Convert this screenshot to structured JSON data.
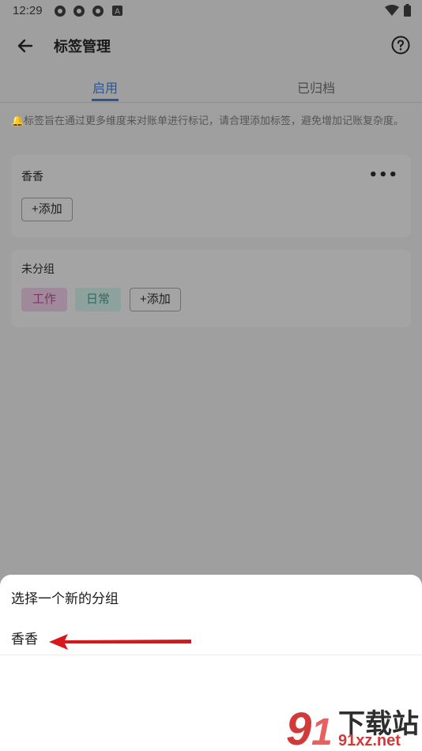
{
  "status_bar": {
    "time": "12:29",
    "icons": [
      "app-icon",
      "app-icon",
      "app-icon",
      "a-icon",
      "wifi-icon",
      "battery-icon"
    ]
  },
  "app_bar": {
    "title": "标签管理",
    "back_icon": "arrow-left-icon",
    "help_icon": "help-circle-icon"
  },
  "tabs": [
    {
      "label": "启用",
      "active": true
    },
    {
      "label": "已归档",
      "active": false
    }
  ],
  "notice": {
    "icon": "bell-icon",
    "text": "标签旨在通过更多维度来对账单进行标记，请合理添加标签，避免增加记账复杂度。"
  },
  "groups": [
    {
      "name": "香香",
      "tags": [],
      "add_label": "+添加",
      "more_icon": "more-icon"
    },
    {
      "name": "未分组",
      "tags": [
        {
          "label": "工作",
          "color": "#783566"
        },
        {
          "label": "日常",
          "color": "#2f6b5e"
        }
      ],
      "add_label": "+添加"
    }
  ],
  "sheet": {
    "title": "选择一个新的分组",
    "items": [
      {
        "label": "香香"
      }
    ]
  },
  "watermark": {
    "brand": "下载站",
    "url": "91xz.net"
  },
  "colors": {
    "accent": "#2d5690",
    "overlay": "#9f9f9f",
    "arrow": "#d8161b"
  }
}
